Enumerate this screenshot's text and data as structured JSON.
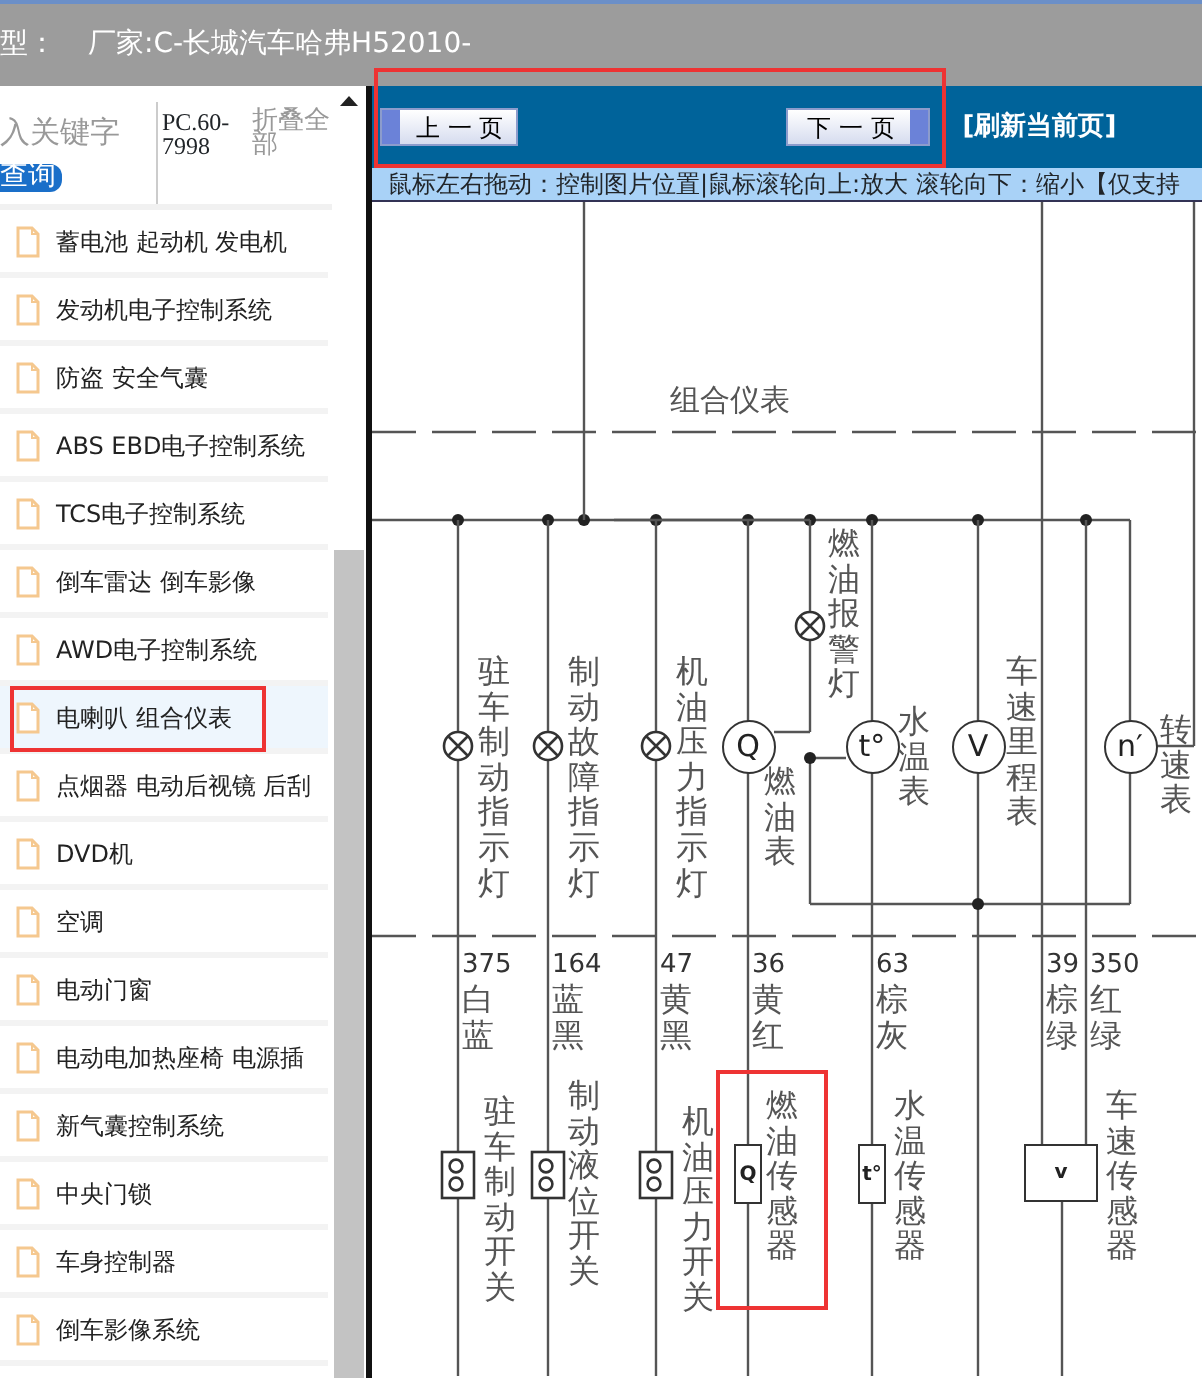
{
  "header": {
    "model_label": "型：",
    "maker": "厂家:C-长城汽车哈弗H52010-"
  },
  "search": {
    "placeholder": "入关键字",
    "button": "查询",
    "code": "PC.60-7998",
    "collapse": "折叠全部"
  },
  "sidebar": {
    "items": [
      {
        "label": "蓄电池 起动机 发电机",
        "selected": false,
        "highlighted": false
      },
      {
        "label": "发动机电子控制系统",
        "selected": false,
        "highlighted": false
      },
      {
        "label": "防盗 安全气囊",
        "selected": false,
        "highlighted": false
      },
      {
        "label": "ABS EBD电子控制系统",
        "selected": false,
        "highlighted": false
      },
      {
        "label": "TCS电子控制系统",
        "selected": false,
        "highlighted": false
      },
      {
        "label": "倒车雷达 倒车影像",
        "selected": false,
        "highlighted": false
      },
      {
        "label": "AWD电子控制系统",
        "selected": false,
        "highlighted": false
      },
      {
        "label": "电喇叭 组合仪表",
        "selected": true,
        "highlighted": true
      },
      {
        "label": "点烟器 电动后视镜 后刮",
        "selected": false,
        "highlighted": false
      },
      {
        "label": "DVD机",
        "selected": false,
        "highlighted": false
      },
      {
        "label": "空调",
        "selected": false,
        "highlighted": false
      },
      {
        "label": "电动门窗",
        "selected": false,
        "highlighted": false
      },
      {
        "label": "电动电加热座椅 电源插",
        "selected": false,
        "highlighted": false
      },
      {
        "label": "新气囊控制系统",
        "selected": false,
        "highlighted": false
      },
      {
        "label": "中央门锁",
        "selected": false,
        "highlighted": false
      },
      {
        "label": "车身控制器",
        "selected": false,
        "highlighted": false
      },
      {
        "label": "倒车影像系统",
        "selected": false,
        "highlighted": false
      }
    ]
  },
  "toolbar": {
    "highlighted": true,
    "prev": "上 一 页",
    "next": "下 一 页",
    "refresh": "[刷新当前页]"
  },
  "hint": "鼠标左右拖动：控制图片位置|鼠标滚轮向上:放大  滚轮向下：缩小【仅支持",
  "diagram": {
    "section_label": "组合仪表",
    "instruments": [
      {
        "kind": "lamp",
        "label": "驻车制动指示灯"
      },
      {
        "kind": "lamp",
        "label": "制动故障指示灯"
      },
      {
        "kind": "lamp",
        "label": "机油压力指示灯"
      },
      {
        "kind": "gauge",
        "symbol": "Q",
        "label": "燃油表"
      },
      {
        "kind": "lamp",
        "label": "燃油报警灯"
      },
      {
        "kind": "gauge",
        "symbol": "t°",
        "label": "水温表"
      },
      {
        "kind": "gauge",
        "symbol": "V",
        "label": "车速里程表"
      },
      {
        "kind": "gauge",
        "symbol": "n′",
        "label": "转速表"
      }
    ],
    "wires": [
      {
        "number": "375",
        "insulation": "白蓝"
      },
      {
        "number": "164",
        "insulation": "蓝黑"
      },
      {
        "number": "47",
        "insulation": "黄黑"
      },
      {
        "number": "36",
        "insulation": "黄红"
      },
      {
        "number": "63",
        "insulation": "棕灰"
      },
      {
        "number": "39",
        "insulation": "棕绿"
      },
      {
        "number": "350",
        "insulation": "红绿"
      }
    ],
    "sensors": [
      {
        "kind": "switch",
        "label": "驻车制动开关",
        "highlighted": false
      },
      {
        "kind": "switch",
        "label": "制动液位开关",
        "highlighted": false
      },
      {
        "kind": "switch",
        "label": "机油压力开关",
        "highlighted": false
      },
      {
        "kind": "sensor",
        "symbol": "Q",
        "label": "燃油传感器",
        "highlighted": true
      },
      {
        "kind": "sensor",
        "symbol": "t°",
        "label": "水温传感器",
        "highlighted": false
      },
      {
        "kind": "box",
        "symbol": "v",
        "label": "车速传感器",
        "highlighted": false
      }
    ]
  }
}
